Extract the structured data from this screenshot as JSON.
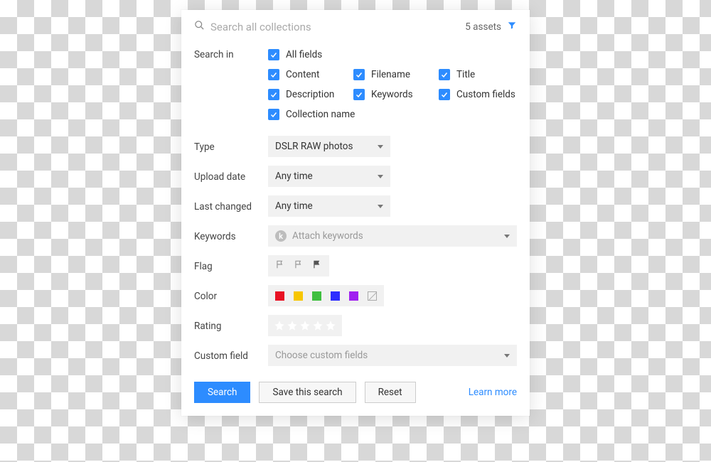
{
  "search": {
    "placeholder": "Search all collections",
    "asset_count": "5 assets"
  },
  "labels": {
    "search_in": "Search in",
    "type": "Type",
    "upload_date": "Upload date",
    "last_changed": "Last changed",
    "keywords": "Keywords",
    "flag": "Flag",
    "color": "Color",
    "rating": "Rating",
    "custom_field": "Custom field"
  },
  "search_in": {
    "all_fields": "All fields",
    "content": "Content",
    "filename": "Filename",
    "title": "Title",
    "description": "Description",
    "keywords": "Keywords",
    "custom_fields": "Custom fields",
    "collection_name": "Collection name"
  },
  "selects": {
    "type": "DSLR RAW photos",
    "upload_date": "Any time",
    "last_changed": "Any time",
    "keywords_placeholder": "Attach keywords",
    "custom_field_placeholder": "Choose custom fields"
  },
  "colors": {
    "red": "#e81123",
    "yellow": "#f7c600",
    "green": "#3fbf3f",
    "blue": "#2d2dff",
    "purple": "#a020f0"
  },
  "buttons": {
    "search": "Search",
    "save": "Save this search",
    "reset": "Reset",
    "learn_more": "Learn more"
  }
}
